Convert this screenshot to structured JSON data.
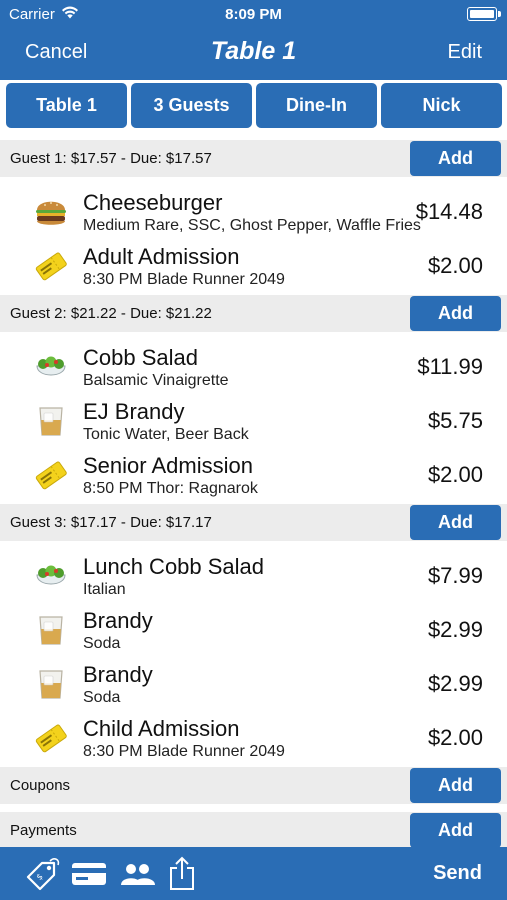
{
  "status": {
    "carrier": "Carrier",
    "time": "8:09 PM"
  },
  "nav": {
    "cancel": "Cancel",
    "title": "Table 1",
    "edit": "Edit"
  },
  "segments": [
    "Table 1",
    "3 Guests",
    "Dine-In",
    "Nick"
  ],
  "sections": [
    {
      "title": "Guest 1: $17.57 - Due: $17.57",
      "add": "Add",
      "items": [
        {
          "icon": "burger-icon",
          "name": "Cheeseburger",
          "mods": "Medium Rare, SSC, Ghost Pepper, Waffle Fries",
          "price": "$14.48"
        },
        {
          "icon": "ticket-icon",
          "name": "Adult Admission",
          "mods": "8:30 PM Blade Runner 2049",
          "price": "$2.00"
        }
      ]
    },
    {
      "title": "Guest 2: $21.22 - Due: $21.22",
      "add": "Add",
      "items": [
        {
          "icon": "salad-icon",
          "name": "Cobb Salad",
          "mods": "Balsamic Vinaigrette",
          "price": "$11.99"
        },
        {
          "icon": "glass-icon",
          "name": "EJ Brandy",
          "mods": "Tonic Water, Beer Back",
          "price": "$5.75"
        },
        {
          "icon": "ticket-icon",
          "name": "Senior Admission",
          "mods": "8:50 PM Thor: Ragnarok",
          "price": "$2.00"
        }
      ]
    },
    {
      "title": "Guest 3: $17.17 - Due: $17.17",
      "add": "Add",
      "items": [
        {
          "icon": "salad-icon",
          "name": "Lunch Cobb Salad",
          "mods": "Italian",
          "price": "$7.99"
        },
        {
          "icon": "glass-icon",
          "name": "Brandy",
          "mods": "Soda",
          "price": "$2.99"
        },
        {
          "icon": "glass-icon",
          "name": "Brandy",
          "mods": "Soda",
          "price": "$2.99"
        },
        {
          "icon": "ticket-icon",
          "name": "Child Admission",
          "mods": "8:30 PM Blade Runner 2049",
          "price": "$2.00"
        }
      ]
    },
    {
      "title": "Coupons",
      "add": "Add",
      "items": []
    },
    {
      "title": "Payments",
      "add": "Add",
      "items": []
    }
  ],
  "footer": {
    "icons": [
      "tag-icon",
      "credit-card-icon",
      "guests-icon",
      "share-icon"
    ],
    "send": "Send"
  }
}
